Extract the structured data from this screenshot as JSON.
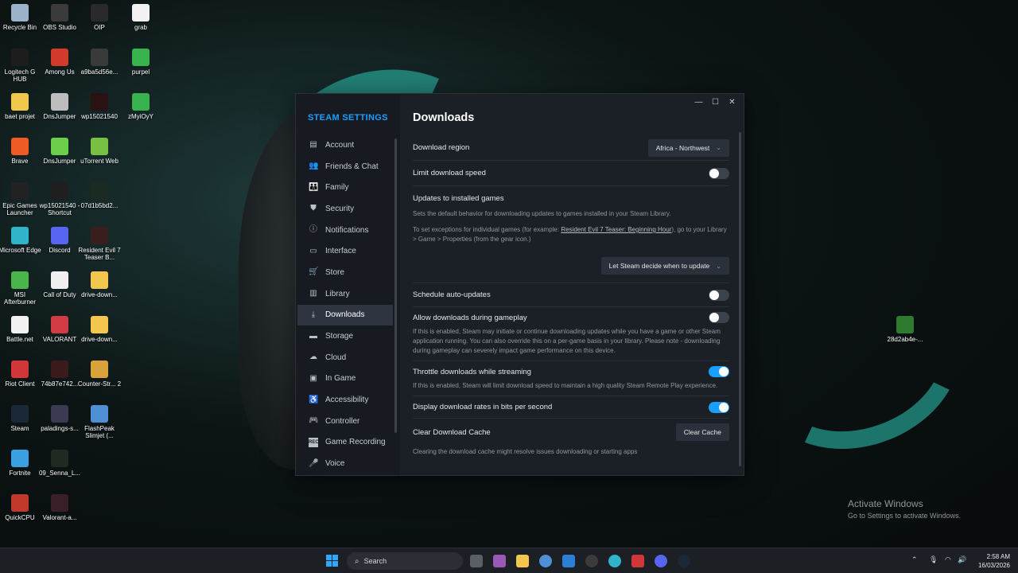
{
  "desktop": {
    "icons": [
      {
        "label": "Recycle Bin",
        "color": "#9ab3c8"
      },
      {
        "label": "OBS Studio",
        "color": "#3b3b3b"
      },
      {
        "label": "OIP",
        "color": "#2a2a2a"
      },
      {
        "label": "grab",
        "color": "#f2f2f2"
      },
      {
        "label": "Logitech G HUB",
        "color": "#1d1d1d"
      },
      {
        "label": "Among Us",
        "color": "#d23a2c"
      },
      {
        "label": "a9ba5d56e...",
        "color": "#3a3a3a"
      },
      {
        "label": "purpel",
        "color": "#37b24d"
      },
      {
        "label": "baet projet",
        "color": "#f3c74d"
      },
      {
        "label": "DnsJumper",
        "color": "#bdbdbd"
      },
      {
        "label": "wp15021540",
        "color": "#2a1212"
      },
      {
        "label": "zMyiOyY",
        "color": "#37b24d"
      },
      {
        "label": "Brave",
        "color": "#f05a24"
      },
      {
        "label": "DnsJumper",
        "color": "#6ccf4b"
      },
      {
        "label": "uTorrent Web",
        "color": "#78c043"
      },
      {
        "label": "Epic Games Launcher",
        "color": "#222222"
      },
      {
        "label": "wp15021540 - Shortcut",
        "color": "#1f1f1f"
      },
      {
        "label": "07d1b5bd2...",
        "color": "#1c2a24"
      },
      {
        "label": "Microsoft Edge",
        "color": "#2fb4c9"
      },
      {
        "label": "Discord",
        "color": "#5865f2"
      },
      {
        "label": "Resident Evil 7 Teaser B...",
        "color": "#3a1d1d"
      },
      {
        "label": "MSI Afterburner",
        "color": "#4ab54a"
      },
      {
        "label": "Call of Duty",
        "color": "#efefef"
      },
      {
        "label": "drive-down...",
        "color": "#f3c74d"
      },
      {
        "label": "Battle.net",
        "color": "#f2f2f2"
      },
      {
        "label": "VALORANT",
        "color": "#d13b44"
      },
      {
        "label": "drive-down...",
        "color": "#f3c74d"
      },
      {
        "label": "Riot Client",
        "color": "#d13639"
      },
      {
        "label": "74b87e742...",
        "color": "#3a1a1a"
      },
      {
        "label": "Counter-Str... 2",
        "color": "#d9a23a"
      },
      {
        "label": "Steam",
        "color": "#1b2838"
      },
      {
        "label": "paladings-s...",
        "color": "#3a3a55"
      },
      {
        "label": "FlashPeak Slimjet (...",
        "color": "#4e8fd6"
      },
      {
        "label": "Fortnite",
        "color": "#3aa0e0"
      },
      {
        "label": "09_Senna_L...",
        "color": "#1e2a22"
      },
      {
        "label": "QuickCPU",
        "color": "#c0392b"
      },
      {
        "label": "Valorant-a...",
        "color": "#3a1f28"
      }
    ],
    "lone_icon": {
      "label": "28d2ab4e-...",
      "color": "#2f7a2f"
    }
  },
  "window": {
    "controls": {
      "minimize": "—",
      "maximize": "☐",
      "close": "✕"
    },
    "sidebar": {
      "title": "STEAM SETTINGS",
      "items": [
        {
          "label": "Account",
          "icon": "▤"
        },
        {
          "label": "Friends & Chat",
          "icon": "👥"
        },
        {
          "label": "Family",
          "icon": "👪"
        },
        {
          "label": "Security",
          "icon": "⛊"
        },
        {
          "label": "Notifications",
          "icon": "ⓘ"
        },
        {
          "label": "Interface",
          "icon": "▭"
        },
        {
          "label": "Store",
          "icon": "🛒"
        },
        {
          "label": "Library",
          "icon": "▥"
        },
        {
          "label": "Downloads",
          "icon": "⤓"
        },
        {
          "label": "Storage",
          "icon": "▬"
        },
        {
          "label": "Cloud",
          "icon": "☁"
        },
        {
          "label": "In Game",
          "icon": "▣"
        },
        {
          "label": "Accessibility",
          "icon": "♿"
        },
        {
          "label": "Controller",
          "icon": "🎮"
        },
        {
          "label": "Game Recording",
          "icon": "REC"
        },
        {
          "label": "Voice",
          "icon": "🎤"
        }
      ],
      "active": "Downloads"
    },
    "main": {
      "title": "Downloads",
      "download_region_label": "Download region",
      "download_region_value": "Africa - Northwest",
      "limit_speed_label": "Limit download speed",
      "limit_speed_on": false,
      "updates_label": "Updates to installed games",
      "updates_desc": "Sets the default behavior for downloading updates to games installed in your Steam Library.",
      "updates_exceptions_pre": "To set exceptions for individual games (for example: ",
      "updates_exceptions_link": "Resident Evil 7 Teaser: Beginning Hour",
      "updates_exceptions_post": "), go to your Library > Game > Properties (from the gear icon.)",
      "update_mode_value": "Let Steam decide when to update",
      "schedule_label": "Schedule auto-updates",
      "schedule_on": false,
      "allow_gameplay_label": "Allow downloads during gameplay",
      "allow_gameplay_on": false,
      "allow_gameplay_desc": "If this is enabled, Steam may initiate or continue downloading updates while you have a game or other Steam application running. You can also override this on a per-game basis in your library. Please note - downloading during gameplay can severely impact game performance on this device.",
      "throttle_label": "Throttle downloads while streaming",
      "throttle_on": true,
      "throttle_desc": "If this is enabled, Steam will limit download speed to maintain a high quality Steam Remote Play experience.",
      "bits_label": "Display download rates in bits per second",
      "bits_on": true,
      "clear_cache_label": "Clear Download Cache",
      "clear_cache_button": "Clear Cache",
      "clear_cache_desc": "Clearing the download cache might resolve issues downloading or starting apps"
    }
  },
  "activate": {
    "title": "Activate Windows",
    "subtitle": "Go to Settings to activate Windows."
  },
  "taskbar": {
    "search_placeholder": "Search",
    "time": "2:58 AM",
    "date": "16/03/2026"
  }
}
